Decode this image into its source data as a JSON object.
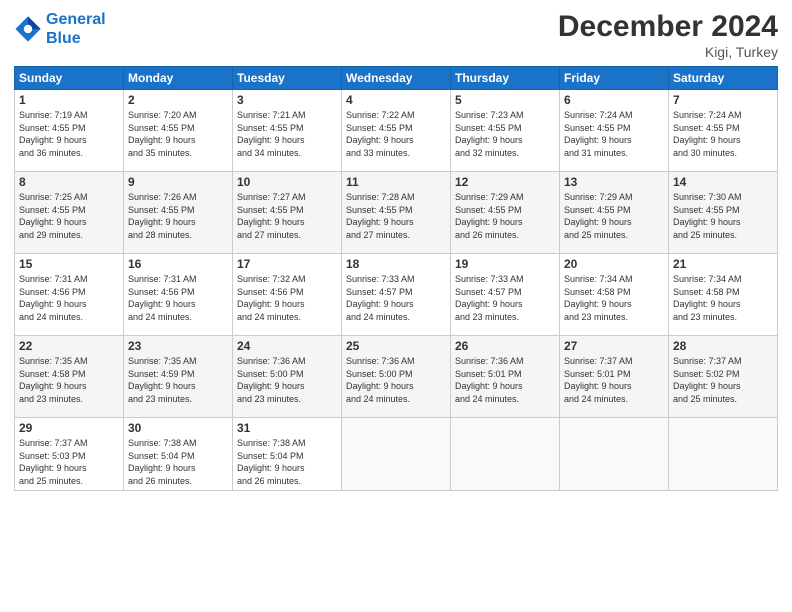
{
  "header": {
    "logo_line1": "General",
    "logo_line2": "Blue",
    "month": "December 2024",
    "location": "Kigi, Turkey"
  },
  "days_of_week": [
    "Sunday",
    "Monday",
    "Tuesday",
    "Wednesday",
    "Thursday",
    "Friday",
    "Saturday"
  ],
  "weeks": [
    [
      {
        "num": "1",
        "sunrise": "7:19 AM",
        "sunset": "4:55 PM",
        "daylight_h": "9 hours",
        "daylight_m": "36 minutes."
      },
      {
        "num": "2",
        "sunrise": "7:20 AM",
        "sunset": "4:55 PM",
        "daylight_h": "9 hours",
        "daylight_m": "35 minutes."
      },
      {
        "num": "3",
        "sunrise": "7:21 AM",
        "sunset": "4:55 PM",
        "daylight_h": "9 hours",
        "daylight_m": "34 minutes."
      },
      {
        "num": "4",
        "sunrise": "7:22 AM",
        "sunset": "4:55 PM",
        "daylight_h": "9 hours",
        "daylight_m": "33 minutes."
      },
      {
        "num": "5",
        "sunrise": "7:23 AM",
        "sunset": "4:55 PM",
        "daylight_h": "9 hours",
        "daylight_m": "32 minutes."
      },
      {
        "num": "6",
        "sunrise": "7:24 AM",
        "sunset": "4:55 PM",
        "daylight_h": "9 hours",
        "daylight_m": "31 minutes."
      },
      {
        "num": "7",
        "sunrise": "7:24 AM",
        "sunset": "4:55 PM",
        "daylight_h": "9 hours",
        "daylight_m": "30 minutes."
      }
    ],
    [
      {
        "num": "8",
        "sunrise": "7:25 AM",
        "sunset": "4:55 PM",
        "daylight_h": "9 hours",
        "daylight_m": "29 minutes."
      },
      {
        "num": "9",
        "sunrise": "7:26 AM",
        "sunset": "4:55 PM",
        "daylight_h": "9 hours",
        "daylight_m": "28 minutes."
      },
      {
        "num": "10",
        "sunrise": "7:27 AM",
        "sunset": "4:55 PM",
        "daylight_h": "9 hours",
        "daylight_m": "27 minutes."
      },
      {
        "num": "11",
        "sunrise": "7:28 AM",
        "sunset": "4:55 PM",
        "daylight_h": "9 hours",
        "daylight_m": "27 minutes."
      },
      {
        "num": "12",
        "sunrise": "7:29 AM",
        "sunset": "4:55 PM",
        "daylight_h": "9 hours",
        "daylight_m": "26 minutes."
      },
      {
        "num": "13",
        "sunrise": "7:29 AM",
        "sunset": "4:55 PM",
        "daylight_h": "9 hours",
        "daylight_m": "25 minutes."
      },
      {
        "num": "14",
        "sunrise": "7:30 AM",
        "sunset": "4:55 PM",
        "daylight_h": "9 hours",
        "daylight_m": "25 minutes."
      }
    ],
    [
      {
        "num": "15",
        "sunrise": "7:31 AM",
        "sunset": "4:56 PM",
        "daylight_h": "9 hours",
        "daylight_m": "24 minutes."
      },
      {
        "num": "16",
        "sunrise": "7:31 AM",
        "sunset": "4:56 PM",
        "daylight_h": "9 hours",
        "daylight_m": "24 minutes."
      },
      {
        "num": "17",
        "sunrise": "7:32 AM",
        "sunset": "4:56 PM",
        "daylight_h": "9 hours",
        "daylight_m": "24 minutes."
      },
      {
        "num": "18",
        "sunrise": "7:33 AM",
        "sunset": "4:57 PM",
        "daylight_h": "9 hours",
        "daylight_m": "24 minutes."
      },
      {
        "num": "19",
        "sunrise": "7:33 AM",
        "sunset": "4:57 PM",
        "daylight_h": "9 hours",
        "daylight_m": "23 minutes."
      },
      {
        "num": "20",
        "sunrise": "7:34 AM",
        "sunset": "4:58 PM",
        "daylight_h": "9 hours",
        "daylight_m": "23 minutes."
      },
      {
        "num": "21",
        "sunrise": "7:34 AM",
        "sunset": "4:58 PM",
        "daylight_h": "9 hours",
        "daylight_m": "23 minutes."
      }
    ],
    [
      {
        "num": "22",
        "sunrise": "7:35 AM",
        "sunset": "4:58 PM",
        "daylight_h": "9 hours",
        "daylight_m": "23 minutes."
      },
      {
        "num": "23",
        "sunrise": "7:35 AM",
        "sunset": "4:59 PM",
        "daylight_h": "9 hours",
        "daylight_m": "23 minutes."
      },
      {
        "num": "24",
        "sunrise": "7:36 AM",
        "sunset": "5:00 PM",
        "daylight_h": "9 hours",
        "daylight_m": "23 minutes."
      },
      {
        "num": "25",
        "sunrise": "7:36 AM",
        "sunset": "5:00 PM",
        "daylight_h": "9 hours",
        "daylight_m": "24 minutes."
      },
      {
        "num": "26",
        "sunrise": "7:36 AM",
        "sunset": "5:01 PM",
        "daylight_h": "9 hours",
        "daylight_m": "24 minutes."
      },
      {
        "num": "27",
        "sunrise": "7:37 AM",
        "sunset": "5:01 PM",
        "daylight_h": "9 hours",
        "daylight_m": "24 minutes."
      },
      {
        "num": "28",
        "sunrise": "7:37 AM",
        "sunset": "5:02 PM",
        "daylight_h": "9 hours",
        "daylight_m": "25 minutes."
      }
    ],
    [
      {
        "num": "29",
        "sunrise": "7:37 AM",
        "sunset": "5:03 PM",
        "daylight_h": "9 hours",
        "daylight_m": "25 minutes."
      },
      {
        "num": "30",
        "sunrise": "7:38 AM",
        "sunset": "5:04 PM",
        "daylight_h": "9 hours",
        "daylight_m": "26 minutes."
      },
      {
        "num": "31",
        "sunrise": "7:38 AM",
        "sunset": "5:04 PM",
        "daylight_h": "9 hours",
        "daylight_m": "26 minutes."
      },
      null,
      null,
      null,
      null
    ]
  ]
}
